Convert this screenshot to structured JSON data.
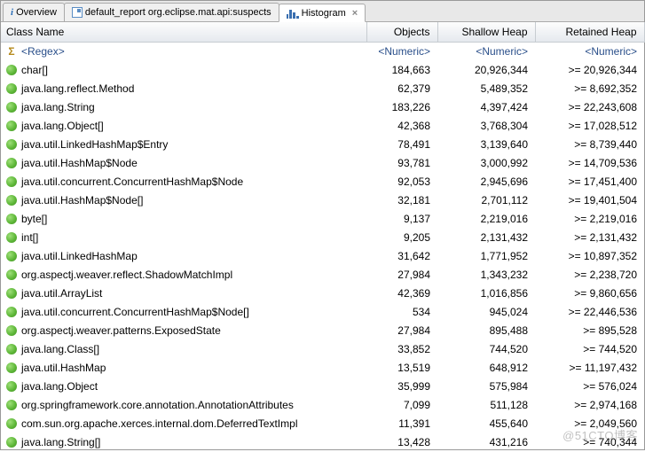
{
  "tabs": [
    {
      "label": "Overview",
      "icon": "info",
      "closable": false
    },
    {
      "label": "default_report  org.eclipse.mat.api:suspects",
      "icon": "doc",
      "closable": false
    },
    {
      "label": "Histogram",
      "icon": "histo",
      "closable": true,
      "active": true
    }
  ],
  "columns": {
    "name": "Class Name",
    "objects": "Objects",
    "shallow": "Shallow Heap",
    "retained": "Retained Heap"
  },
  "regex_row": {
    "name": "<Regex>",
    "objects": "<Numeric>",
    "shallow": "<Numeric>",
    "retained": "<Numeric>"
  },
  "rows": [
    {
      "name": "char[]",
      "objects": "184,663",
      "shallow": "20,926,344",
      "retained": ">= 20,926,344"
    },
    {
      "name": "java.lang.reflect.Method",
      "objects": "62,379",
      "shallow": "5,489,352",
      "retained": ">= 8,692,352"
    },
    {
      "name": "java.lang.String",
      "objects": "183,226",
      "shallow": "4,397,424",
      "retained": ">= 22,243,608"
    },
    {
      "name": "java.lang.Object[]",
      "objects": "42,368",
      "shallow": "3,768,304",
      "retained": ">= 17,028,512"
    },
    {
      "name": "java.util.LinkedHashMap$Entry",
      "objects": "78,491",
      "shallow": "3,139,640",
      "retained": ">= 8,739,440"
    },
    {
      "name": "java.util.HashMap$Node",
      "objects": "93,781",
      "shallow": "3,000,992",
      "retained": ">= 14,709,536"
    },
    {
      "name": "java.util.concurrent.ConcurrentHashMap$Node",
      "objects": "92,053",
      "shallow": "2,945,696",
      "retained": ">= 17,451,400"
    },
    {
      "name": "java.util.HashMap$Node[]",
      "objects": "32,181",
      "shallow": "2,701,112",
      "retained": ">= 19,401,504"
    },
    {
      "name": "byte[]",
      "objects": "9,137",
      "shallow": "2,219,016",
      "retained": ">= 2,219,016"
    },
    {
      "name": "int[]",
      "objects": "9,205",
      "shallow": "2,131,432",
      "retained": ">= 2,131,432"
    },
    {
      "name": "java.util.LinkedHashMap",
      "objects": "31,642",
      "shallow": "1,771,952",
      "retained": ">= 10,897,352"
    },
    {
      "name": "org.aspectj.weaver.reflect.ShadowMatchImpl",
      "objects": "27,984",
      "shallow": "1,343,232",
      "retained": ">= 2,238,720"
    },
    {
      "name": "java.util.ArrayList",
      "objects": "42,369",
      "shallow": "1,016,856",
      "retained": ">= 9,860,656"
    },
    {
      "name": "java.util.concurrent.ConcurrentHashMap$Node[]",
      "objects": "534",
      "shallow": "945,024",
      "retained": ">= 22,446,536"
    },
    {
      "name": "org.aspectj.weaver.patterns.ExposedState",
      "objects": "27,984",
      "shallow": "895,488",
      "retained": ">= 895,528"
    },
    {
      "name": "java.lang.Class[]",
      "objects": "33,852",
      "shallow": "744,520",
      "retained": ">= 744,520"
    },
    {
      "name": "java.util.HashMap",
      "objects": "13,519",
      "shallow": "648,912",
      "retained": ">= 11,197,432"
    },
    {
      "name": "java.lang.Object",
      "objects": "35,999",
      "shallow": "575,984",
      "retained": ">= 576,024"
    },
    {
      "name": "org.springframework.core.annotation.AnnotationAttributes",
      "objects": "7,099",
      "shallow": "511,128",
      "retained": ">= 2,974,168"
    },
    {
      "name": "com.sun.org.apache.xerces.internal.dom.DeferredTextImpl",
      "objects": "11,391",
      "shallow": "455,640",
      "retained": ">= 2,049,560"
    },
    {
      "name": "java.lang.String[]",
      "objects": "13,428",
      "shallow": "431,216",
      "retained": ">= 740,344"
    }
  ],
  "watermark": "@51CTO博客"
}
